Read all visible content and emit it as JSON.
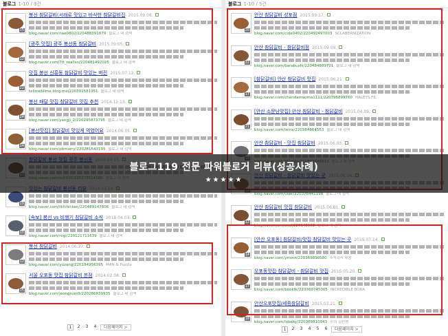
{
  "overlay": {
    "headline": "블로그119 전문 파워블로거 리뷰(성공사례)",
    "stars": "★★★★★"
  },
  "left": {
    "header_title": "블로그",
    "header_sub": "1-10 / 3건",
    "items": [
      {
        "title": "봉선 참닭갈비(서래로 맛있고 바삭한 참닭갈비집",
        "date": "2015.09.08.",
        "meta": "blog.naver.com/nae0802/220488391879",
        "extra": "블로그 내 검색",
        "badge": "15",
        "color": "#8a5a3a"
      },
      {
        "title": "[광주 맛집] 광주 봉선동 참닭갈비",
        "date": "2015.09.05.",
        "meta": "blog.naver.com/7tt_reallsn/220481492025",
        "extra": "블로그 내 검색",
        "badge": "12",
        "color": "#a0683c"
      },
      {
        "title": "맛집 봉선 신흥동 참닭갈비 맛있는 버전",
        "date": "2015.07.12.",
        "meta": "tellmeblime.blog.me/220391581951",
        "extra": "블로그 내 검색",
        "badge": "22",
        "color": "#9b5d34"
      },
      {
        "title": "봉선 배달 맛집 참닭갈비 맛집 추천",
        "date": "2014.12.13.",
        "meta": "blog.naver.com/yangji_2/220295873795",
        "extra": "블로그 내 검색",
        "badge": "24",
        "color": "#7e5233"
      },
      {
        "title": "[봉선맛집] 참닭갈비 맛있게 먹었어요",
        "date": "2014.06.05.",
        "meta": "blog.naver.com/pbmarry/220281543195",
        "extra": "블로그 내 검색",
        "badge": "14",
        "color": "#8e6038"
      },
      {
        "title": "참닭갈비 봉선 맛집 광주 봉선동",
        "date": "2014.04.15.",
        "meta": "blog.naver.com/ss0930/220273514180",
        "extra": "블로그 내 검색",
        "badge": "13",
        "color": "#6f4c35"
      },
      {
        "title": "맛있는 참닭갈비 봉선동 리뷰",
        "date": "2014.03.19.",
        "meta": "blog.naver.com/tkfchicken/220489147806",
        "extra": "블로그 내 검색",
        "badge": "19",
        "color": "#3b4c7a"
      },
      {
        "title": "[속보] 봉선 vs 비행기 참닭갈비 소식",
        "date": "2015.04.03.",
        "meta": "blog.naver.com/rogi/220121711639",
        "extra": "블로그 내 검색",
        "badge": "10",
        "color": "#58606c"
      },
      {
        "title": "봉선 참닭갈비",
        "date": "2014.06.27.",
        "meta": "blog.naver.com/yuzang/220194956395",
        "extra": "MAN & Puzzle",
        "badge": "12",
        "color": "#7c7c7c"
      },
      {
        "title": "서울 오포동 맛집 참닭갈비 본점",
        "date": "2014.02.08.",
        "meta": "blog.naver.com/jeongsum9/220286839935",
        "extra": "블로그 내 검색",
        "badge": "15",
        "color": "#8d5a3b"
      }
    ],
    "pager": [
      "1",
      "2",
      "3",
      "4"
    ],
    "pager_next": "다음페이지 >"
  },
  "right": {
    "header_title": "블로그",
    "header_sub": "1-10 / 5건",
    "items": [
      {
        "title": "안산 참닭갈비 성포점",
        "date": "2015.09.17.",
        "meta": "blog.naver.com/cide0402/220492497003",
        "extra": "SCLABERNIZATION",
        "badge": "20",
        "color": "#9a5f36"
      },
      {
        "title": "안산 참닭갈비 - 참닭갈비점",
        "date": "2015.09.09.",
        "meta": "blog.naver.com/barabushi/220484889701",
        "extra": "블로그 내 검색",
        "badge": "22",
        "color": "#865838"
      },
      {
        "title": "[참닭갈비] 안산 참닭갈비 맛집",
        "date": "2015.06.21.",
        "meta": "blog.naver.com/cheridamw/ma1111/220396899760",
        "extra": "HALEYS FIL",
        "badge": "17",
        "color": "#a36b3f"
      },
      {
        "title": "[안산 소문난맛집] 안산 참닭갈비 - 참닭갈비",
        "date": "2015.04.09.",
        "meta": "blog.naver.com/leina/220384864553",
        "extra": "블로그 내 검색",
        "badge": "21",
        "color": "#7d4d2f"
      },
      {
        "title": "안산 참닭갈비 - 맛집 참닭갈비",
        "date": "2015.06.03.",
        "meta": "blog.naver.com/tifamily/220383346512",
        "extra": "블로그 내 검색",
        "badge": "19",
        "color": "#6d6d75"
      },
      {
        "title": "안산 참닭갈비 - 참닭갈비 맛있는 곳",
        "date": "2015.06.04.",
        "meta": "blog.naver.com/0ser/220378441198",
        "extra": "블로그 내 검색",
        "badge": "12",
        "color": "#8a5f3c"
      },
      {
        "title": "안산 참닭갈비 맛집 참닭갈비",
        "date": "2015.06.01.",
        "meta": "blog.naver.com/ssul/220345568",
        "extra": "블로그 내 검색",
        "badge": "12",
        "color": "#7a5030"
      },
      {
        "title": "[안산 오포동] 참닭갈비/맛집 참닭갈비 맛있는 곳",
        "date": "2015.07.14.",
        "meta": "blog.naver.com/ymoot/220369890580",
        "extra": "주식회사 내용",
        "badge": "14",
        "color": "#955e35"
      },
      {
        "title": "오포동맛집 참닭갈비 - 참닭갈비 맛집",
        "date": "2015.05.20.",
        "meta": "blog.naver.com/booktk/220369745005",
        "extra": "INCREDIBLE BORA",
        "badge": "17",
        "color": "#84563a"
      },
      {
        "title": "안산오포맛집/세종참닭갈비",
        "date": "2015.03.21.",
        "meta": "blog.naver.com/lobeky/220369810943",
        "extra": "주의 김진영",
        "badge": "18",
        "color": "#7a5236"
      }
    ],
    "pager": [
      "1",
      "2",
      "3",
      "4",
      "5",
      "6"
    ],
    "pager_next": "다음페이지 >"
  }
}
